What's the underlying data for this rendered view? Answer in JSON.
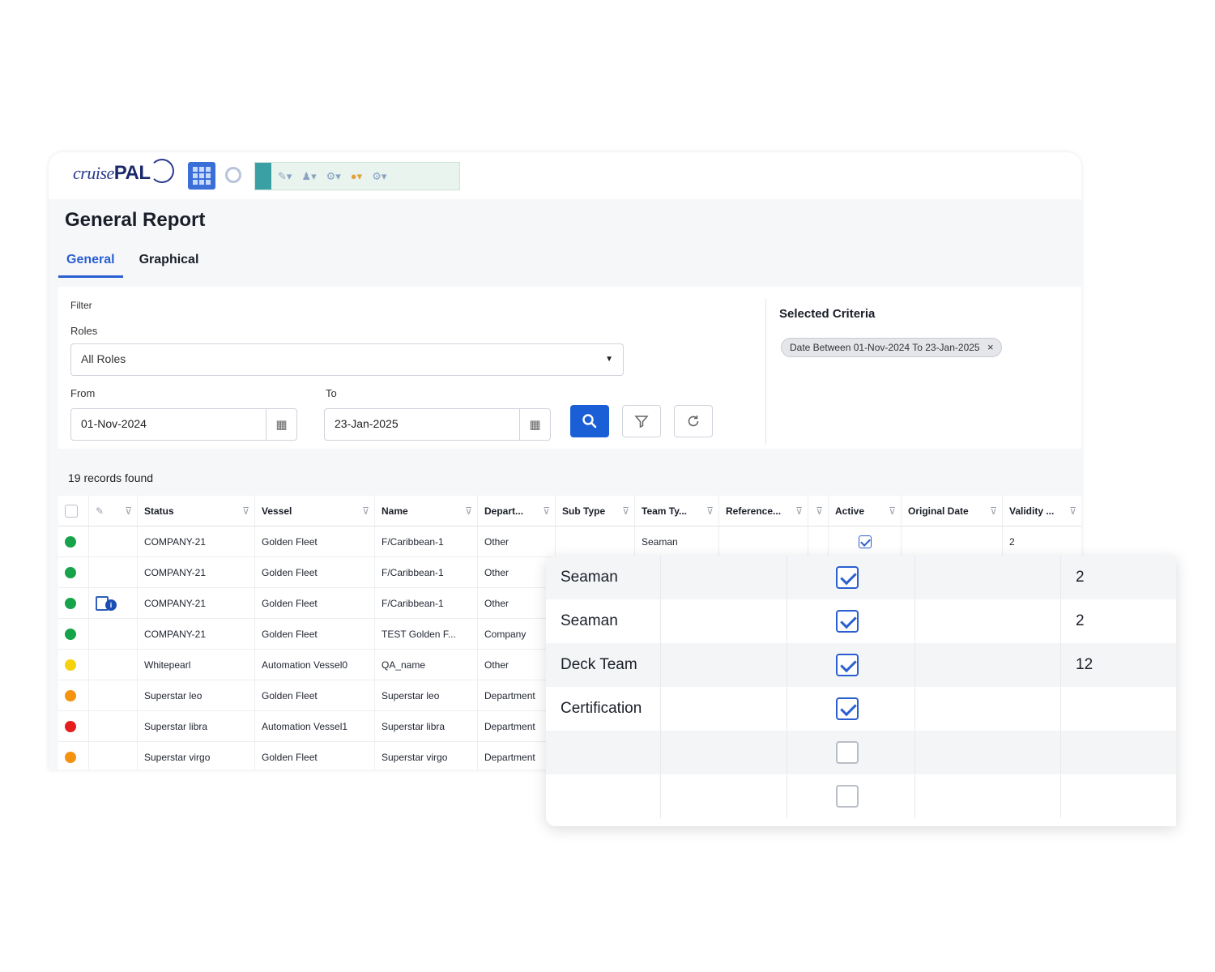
{
  "app": {
    "logo_text_1": "cruise",
    "logo_text_2": "PAL",
    "toolbar_icons": [
      "apps-grid-icon",
      "gear-icon",
      "pin-icon",
      "user-icon",
      "settings-icon",
      "star-icon",
      "help-icon"
    ]
  },
  "page": {
    "title": "General Report",
    "tabs": [
      {
        "label": "General",
        "active": true
      },
      {
        "label": "Graphical",
        "active": false
      }
    ]
  },
  "filter": {
    "section_label": "Filter",
    "roles_label": "Roles",
    "roles_value": "All Roles",
    "from_label": "From",
    "from_value": "01-Nov-2024",
    "to_label": "To",
    "to_value": "23-Jan-2025",
    "search_icon": "search-icon",
    "filter_icon": "filter-icon",
    "reset_icon": "refresh-icon"
  },
  "criteria": {
    "title": "Selected Criteria",
    "chip": "Date Between 01-Nov-2024 To 23-Jan-2025",
    "chip_close": "×"
  },
  "records_found": "19 records found",
  "table": {
    "columns": [
      "",
      "",
      "Status",
      "Vessel",
      "Name",
      "Depart...",
      "Sub Type",
      "Team Ty...",
      "Reference...",
      "",
      "Active",
      "Original Date",
      "Validity ..."
    ],
    "rows": [
      {
        "dot": "#17a34a",
        "icon": false,
        "status": "COMPANY-21",
        "vessel": "Golden Fleet",
        "name": "F/Caribbean-1",
        "dept": "Other",
        "team": "Seaman",
        "active": true,
        "validity": "2"
      },
      {
        "dot": "#17a34a",
        "icon": false,
        "status": "COMPANY-21",
        "vessel": "Golden Fleet",
        "name": "F/Caribbean-1",
        "dept": "Other",
        "team": "",
        "active": false,
        "validity": ""
      },
      {
        "dot": "#17a34a",
        "icon": true,
        "status": "COMPANY-21",
        "vessel": "Golden Fleet",
        "name": "F/Caribbean-1",
        "dept": "Other",
        "team": "",
        "active": false,
        "validity": ""
      },
      {
        "dot": "#17a34a",
        "icon": false,
        "status": "COMPANY-21",
        "vessel": "Golden Fleet",
        "name": "TEST Golden F...",
        "dept": "Company",
        "team": "",
        "active": false,
        "validity": ""
      },
      {
        "dot": "#f5d20c",
        "icon": false,
        "status": "Whitepearl",
        "vessel": "Automation Vessel0",
        "name": "QA_name",
        "dept": "Other",
        "team": "",
        "active": false,
        "validity": ""
      },
      {
        "dot": "#f5920f",
        "icon": false,
        "status": "Superstar leo",
        "vessel": "Golden Fleet",
        "name": "Superstar leo",
        "dept": "Department",
        "team": "",
        "active": false,
        "validity": ""
      },
      {
        "dot": "#e51d1d",
        "icon": false,
        "status": "Superstar libra",
        "vessel": "Automation Vessel1",
        "name": "Superstar libra",
        "dept": "Department",
        "team": "",
        "active": false,
        "validity": ""
      },
      {
        "dot": "#f5920f",
        "icon": false,
        "status": "Superstar virgo",
        "vessel": "Golden Fleet",
        "name": "Superstar virgo",
        "dept": "Department",
        "team": "",
        "active": false,
        "validity": ""
      }
    ]
  },
  "zoom": {
    "rows": [
      {
        "team": "Seaman",
        "active": true,
        "validity": "2"
      },
      {
        "team": "Seaman",
        "active": true,
        "validity": "2"
      },
      {
        "team": "Deck Team",
        "active": true,
        "validity": "12"
      },
      {
        "team": "Certification",
        "active": true,
        "validity": ""
      },
      {
        "team": "",
        "active": false,
        "validity": ""
      },
      {
        "team": "",
        "active": false,
        "validity": ""
      }
    ]
  }
}
